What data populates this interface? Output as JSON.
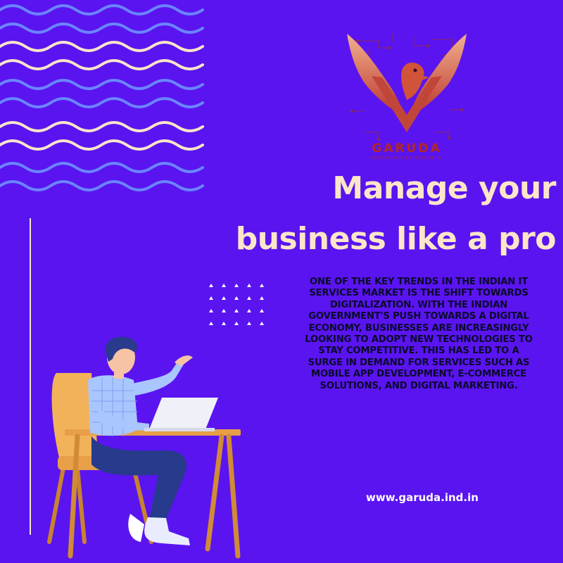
{
  "colors": {
    "background": "#5a14f0",
    "wave_blue": "#6a86ff",
    "wave_cream": "#fbe6c8",
    "headline": "#fbe6c8",
    "logo_red": "#b3271f",
    "body_text": "#0a0a2a"
  },
  "logo": {
    "name": "GARUDA",
    "tagline": "VERITAS MAIN ENTERPRISE TV"
  },
  "headline": {
    "line1": "Manage your",
    "line2": "business like a pro"
  },
  "body": "ONE OF THE KEY TRENDS IN THE INDIAN IT SERVICES MARKET IS THE SHIFT TOWARDS DIGITALIZATION. WITH THE INDIAN GOVERNMENT'S PUSH TOWARDS A DIGITAL ECONOMY, BUSINESSES ARE INCREASINGLY LOOKING TO ADOPT NEW TECHNOLOGIES TO STAY COMPETITIVE. THIS HAS LED TO A SURGE IN DEMAND FOR SERVICES SUCH AS MOBILE APP DEVELOPMENT, E-COMMERCE SOLUTIONS, AND DIGITAL MARKETING.",
  "website": "www.garuda.ind.in",
  "icons": {
    "logo": "garuda-bird-logo-icon",
    "illustration": "person-at-laptop-illustration"
  }
}
